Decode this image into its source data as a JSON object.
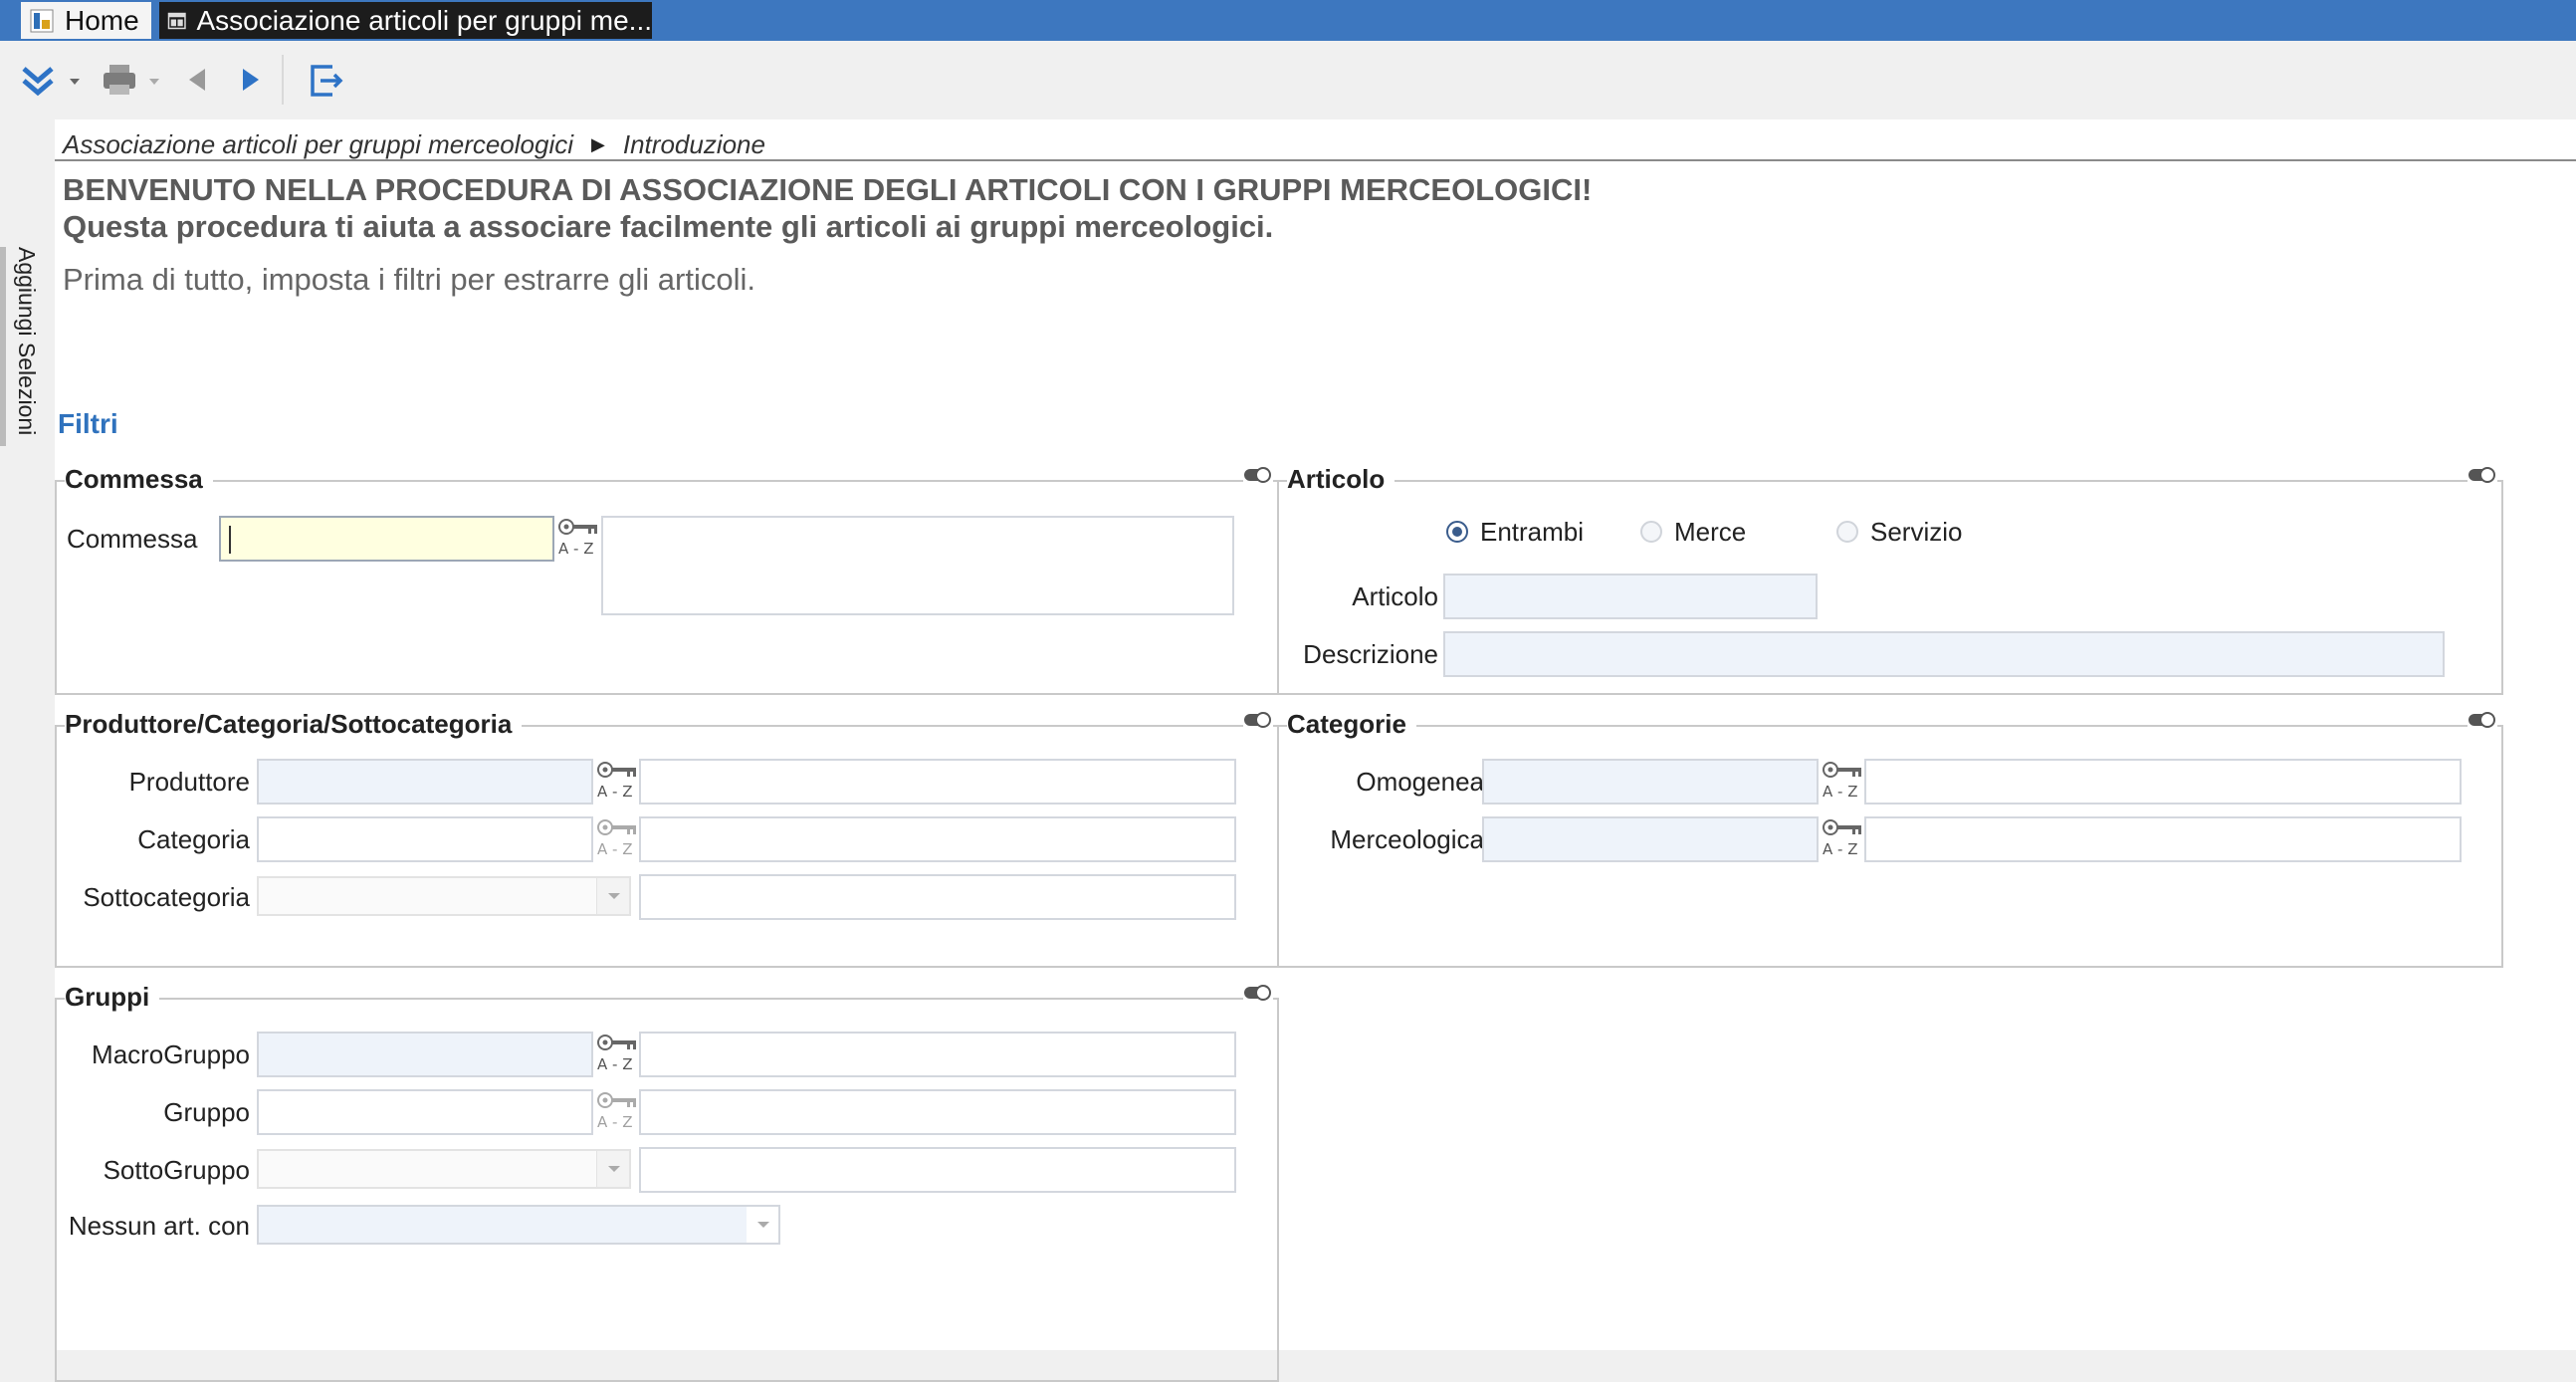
{
  "window": {
    "tab_home": "Home",
    "tab_active": "Associazione articoli per gruppi me..."
  },
  "toolbar": {
    "icons": [
      "expand-all-icon",
      "print-icon",
      "back-icon",
      "forward-icon",
      "exit-icon"
    ]
  },
  "sidebar": {
    "tab_label": "Aggiungi Selezioni"
  },
  "breadcrumb": {
    "items": [
      "Associazione articoli per gruppi merceologici",
      "Introduzione"
    ]
  },
  "intro": {
    "heading": "BENVENUTO NELLA PROCEDURA DI ASSOCIAZIONE DEGLI ARTICOLI CON I GRUPPI MERCEOLOGICI!",
    "subheading": "Questa procedura ti aiuta a associare facilmente gli articoli ai gruppi merceologici.",
    "instruction": "Prima di tutto, imposta i filtri per estrarre gli articoli."
  },
  "filters": {
    "section_title": "Filtri",
    "commessa": {
      "title": "Commessa",
      "label": "Commessa",
      "value": "",
      "description": ""
    },
    "articolo": {
      "title": "Articolo",
      "radios": [
        "Entrambi",
        "Merce",
        "Servizio"
      ],
      "selected": "Entrambi",
      "articolo_label": "Articolo",
      "articolo_value": "",
      "descrizione_label": "Descrizione",
      "descrizione_value": ""
    },
    "produttore": {
      "title": "Produttore/Categoria/Sottocategoria",
      "produttore_label": "Produttore",
      "categoria_label": "Categoria",
      "sottocategoria_label": "Sottocategoria"
    },
    "categorie": {
      "title": "Categorie",
      "omogenea_label": "Omogenea",
      "merceologica_label": "Merceologica"
    },
    "gruppi": {
      "title": "Gruppi",
      "macrogruppo_label": "MacroGruppo",
      "gruppo_label": "Gruppo",
      "sottogruppo_label": "SottoGruppo",
      "nessun_label": "Nessun art. con"
    }
  },
  "colors": {
    "titlebar": "#3d77bf",
    "accent": "#2f72bd",
    "field_blue": "#eef3fa",
    "field_yellow": "#ffffe0"
  }
}
